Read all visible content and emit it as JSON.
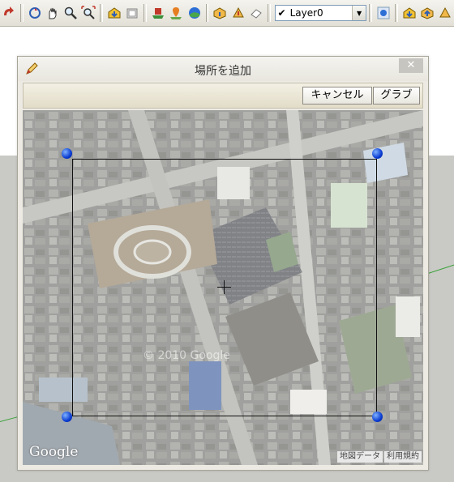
{
  "toolbar": {
    "layer": {
      "check": "✔",
      "name": "Layer0"
    },
    "icons": [
      "rotate-tool-icon",
      "orbit-icon",
      "pan-icon",
      "zoom-icon",
      "zoom-extents-icon",
      "warehouse-get-models-icon",
      "share-model-icon",
      "place-model-icon",
      "add-location-icon",
      "toggle-terrain-icon",
      "photo-textures-icon",
      "components-icon",
      "materials-icon",
      "eraser-icon",
      "layer-manager-icon",
      "get-models-icon",
      "share-component-icon",
      "extension-icon"
    ]
  },
  "dialog": {
    "title": "場所を追加",
    "close_label": "✕",
    "cancel_label": "キャンセル",
    "grab_label": "グラブ"
  },
  "map": {
    "logo": "Google",
    "watermark": "© 2010 Google",
    "map_data_label": "地図データ",
    "terms_label": "利用規約"
  },
  "colors": {
    "handle": "#1a4fe0",
    "toolbar": "#ece9d8",
    "dialog": "#eceae2"
  }
}
